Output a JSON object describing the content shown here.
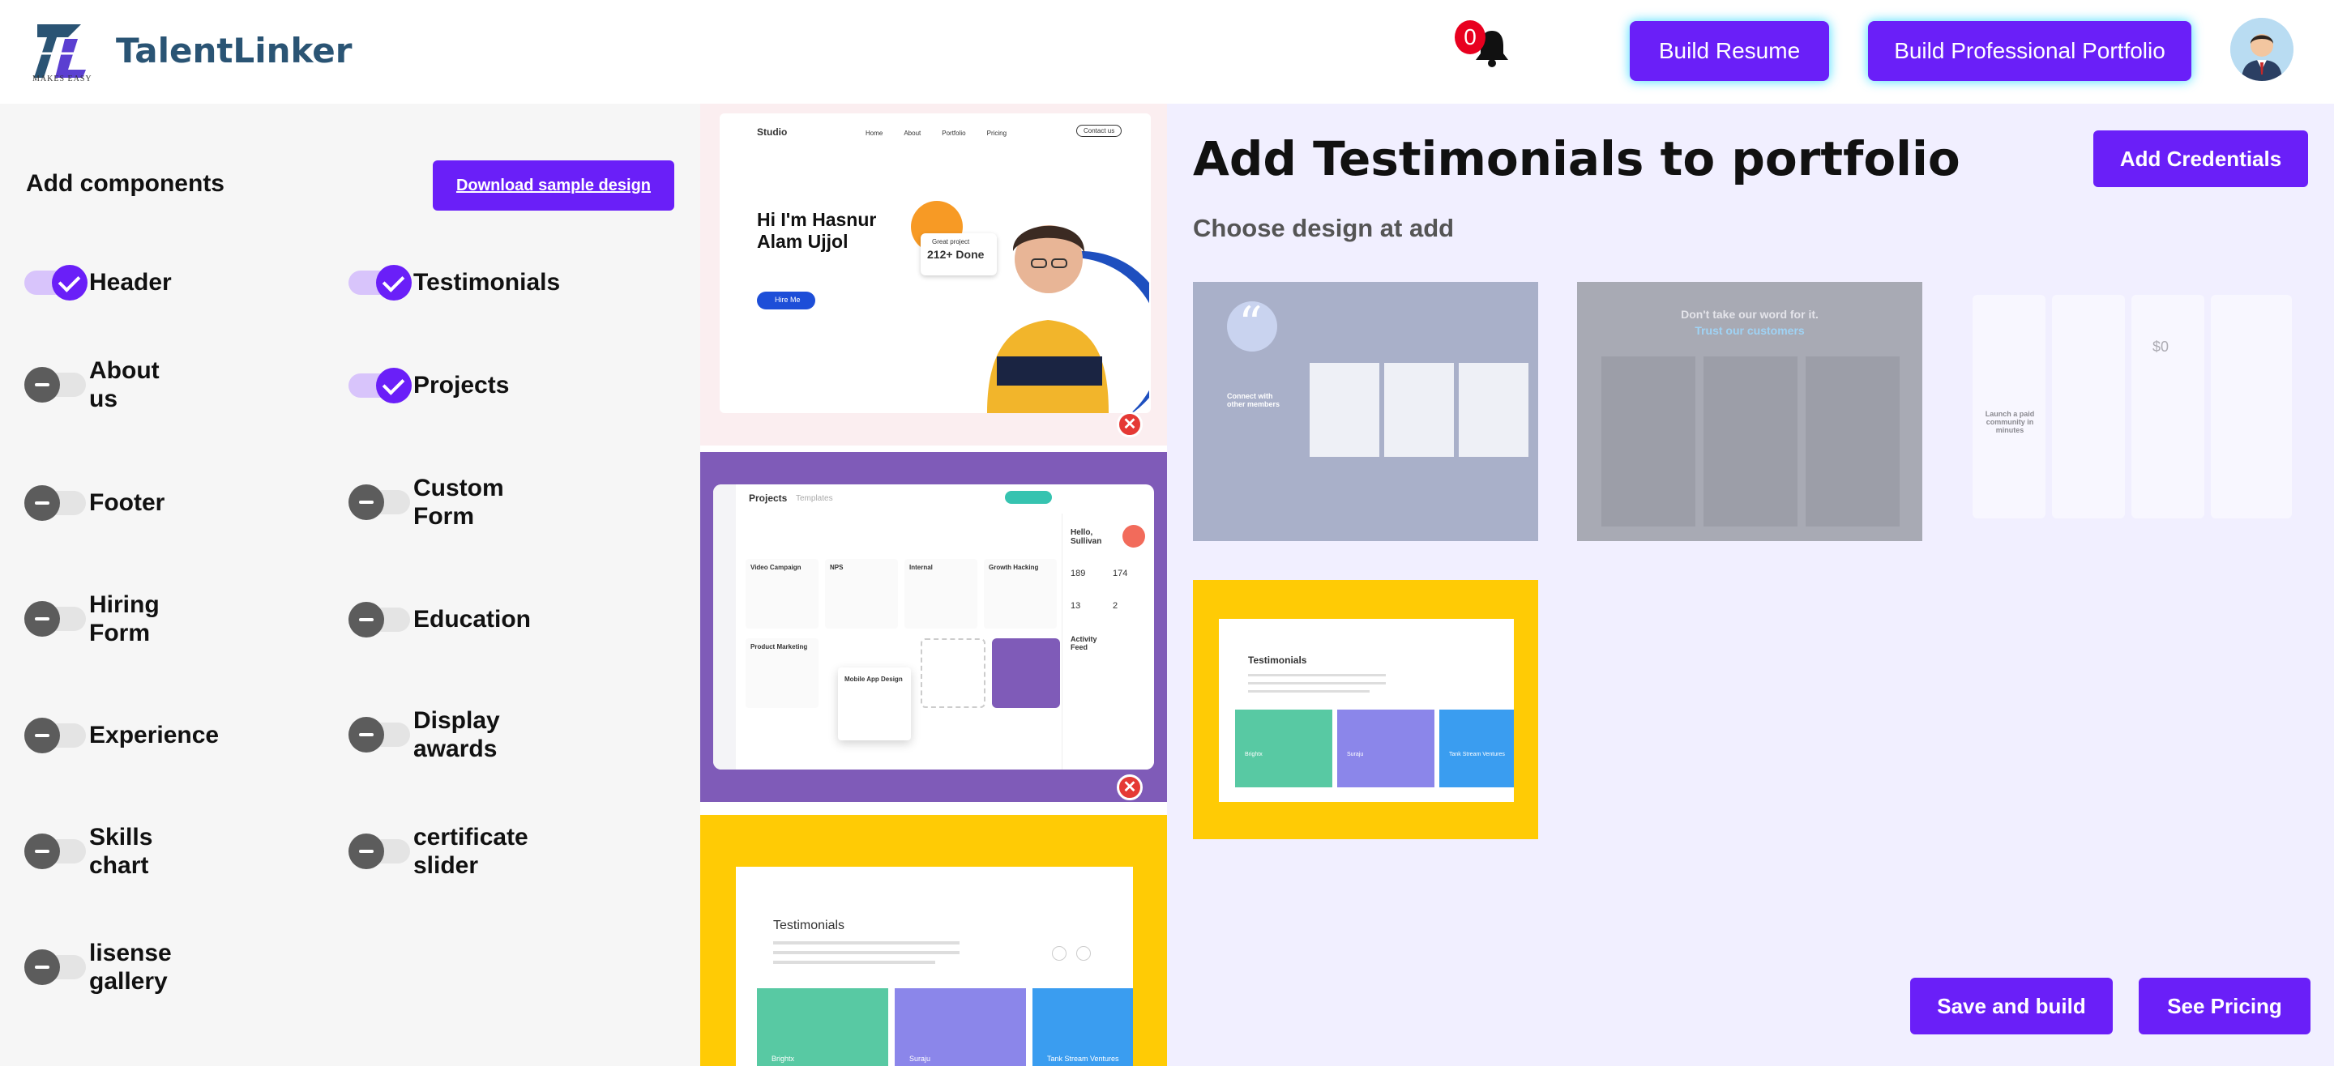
{
  "header": {
    "brand": "TalentLinker",
    "logo_letters": "TL",
    "logo_tagline": "MAKES EASY",
    "notification_count": "0",
    "build_resume_label": "Build Resume",
    "build_portfolio_label": "Build Professional Portfolio",
    "icons": [
      "bell-icon",
      "user-avatar"
    ]
  },
  "components_panel": {
    "title": "Add components",
    "download_label": "Download sample design",
    "items": [
      {
        "label": "Header",
        "on": true
      },
      {
        "label": "Testimonials",
        "on": true
      },
      {
        "label": "About us",
        "on": false
      },
      {
        "label": "Projects",
        "on": true
      },
      {
        "label": "Footer",
        "on": false
      },
      {
        "label": "Custom Form",
        "on": false
      },
      {
        "label": "Hiring Form",
        "on": false
      },
      {
        "label": "Education",
        "on": false
      },
      {
        "label": "Experience",
        "on": false
      },
      {
        "label": "Display awards",
        "on": false
      },
      {
        "label": "Skills chart",
        "on": false
      },
      {
        "label": "certificate slider",
        "on": false
      },
      {
        "label": "lisense gallery",
        "on": false
      }
    ]
  },
  "previews": {
    "header_preview": {
      "studio": "Studio",
      "nav": [
        "Home",
        "About",
        "Portfolio",
        "Pricing",
        "Contact us"
      ],
      "greeting": "Hi I'm Hasnur Alam Ujjol",
      "stat": "212+ Done",
      "stat_caption": "Great project",
      "cta": "Hire Me"
    },
    "projects_preview": {
      "title": "Projects",
      "tab": "Templates",
      "greeting": "Hello, Sullivan",
      "cards": [
        "Video Campaign",
        "NPS",
        "Internal",
        "Growth Hacking",
        "Product Marketing",
        "Mobile App Design"
      ],
      "stats": [
        "189",
        "174",
        "13",
        "2"
      ],
      "feed_title": "Activity Feed"
    },
    "testimonials_preview": {
      "title": "Testimonials",
      "cards": [
        "Brightx",
        "Suraju",
        "Tank Stream Ventures"
      ]
    },
    "close_icon": "close-icon"
  },
  "main": {
    "title": "Add Testimonials to portfolio",
    "subtitle": "Choose design at add",
    "add_credentials_label": "Add Credentials",
    "design1_text": "Connect with other members",
    "design2_heading": "Don't take our word for it.",
    "design2_sub": "Trust our customers",
    "design3_text": "Launch a paid community in minutes",
    "design3_price": "$0",
    "design4_title": "Testimonials",
    "design4_cards": [
      "Brightx",
      "Suraju",
      "Tank Stream Ventures"
    ],
    "save_label": "Save and build",
    "pricing_label": "See Pricing"
  },
  "colors": {
    "accent": "#6a1ff8",
    "brand_text": "#2a5474",
    "yellow": "#ffcb05",
    "purple_bg": "#7f5bb8",
    "badge": "#e8001f"
  }
}
